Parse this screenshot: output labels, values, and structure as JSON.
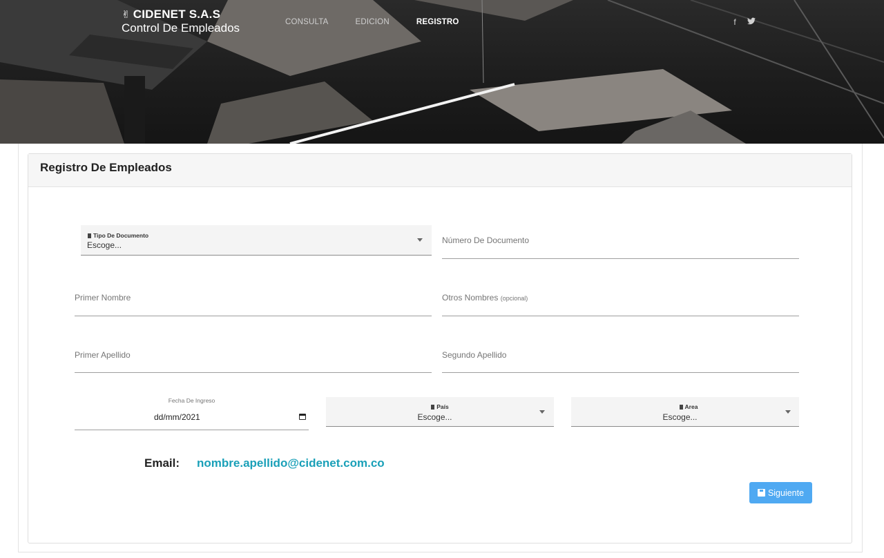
{
  "brand": {
    "name": "CIDENET S.A.S",
    "subtitle": "Control De Empleados",
    "logo_icon": "peace-hand-icon"
  },
  "nav": {
    "items": [
      {
        "label": "CONSULTA",
        "active": false
      },
      {
        "label": "EDICION",
        "active": false
      },
      {
        "label": "REGISTRO",
        "active": true
      }
    ]
  },
  "social": {
    "facebook": "f",
    "twitter": "twitter-bird-icon"
  },
  "card": {
    "title": "Registro De Empleados"
  },
  "form": {
    "tipo_documento": {
      "caption": "Tipo De Documento",
      "value": "Escoge..."
    },
    "numero_documento": {
      "label": "Número De Documento"
    },
    "primer_nombre": {
      "label": "Primer Nombre"
    },
    "otros_nombres": {
      "label": "Otros Nombres",
      "hint": "(opcional)"
    },
    "primer_apellido": {
      "label": "Primer Apellido"
    },
    "segundo_apellido": {
      "label": "Segundo Apellido"
    },
    "fecha_ingreso": {
      "label": "Fecha De Ingreso",
      "value": "dd/mm/2021"
    },
    "pais": {
      "caption": "País",
      "value": "Escoge..."
    },
    "area": {
      "caption": "Area",
      "value": "Escoge..."
    }
  },
  "email": {
    "label": "Email:",
    "value": "nombre.apellido@cidenet.com.co"
  },
  "actions": {
    "next_label": "Siguiente"
  },
  "colors": {
    "accent_email": "#1aa0b8",
    "button": "#4fa9f2"
  }
}
